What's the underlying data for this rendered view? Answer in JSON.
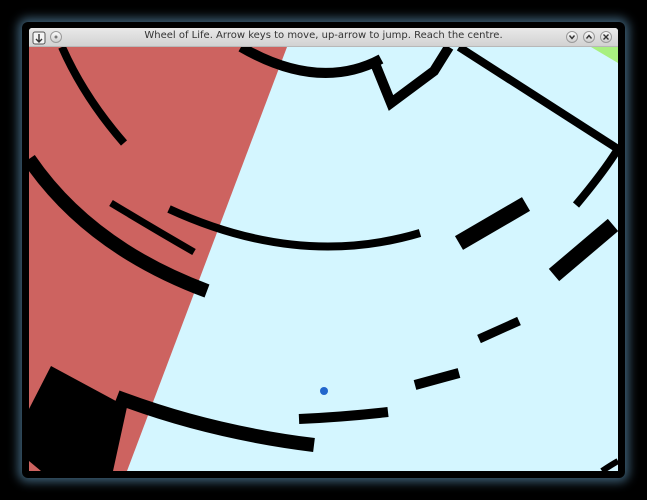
{
  "window": {
    "title": "Wheel of Life. Arrow keys to move, up-arrow to jump. Reach the centre.",
    "buttons": [
      "app-menu",
      "sticky",
      "minimize",
      "maximize",
      "close"
    ]
  },
  "game": {
    "background_color": "#d4f6ff",
    "hazard_color": "#cd6360",
    "wall_color": "#000000",
    "goal_color": "#a8f080",
    "player_color": "#2266cc"
  }
}
